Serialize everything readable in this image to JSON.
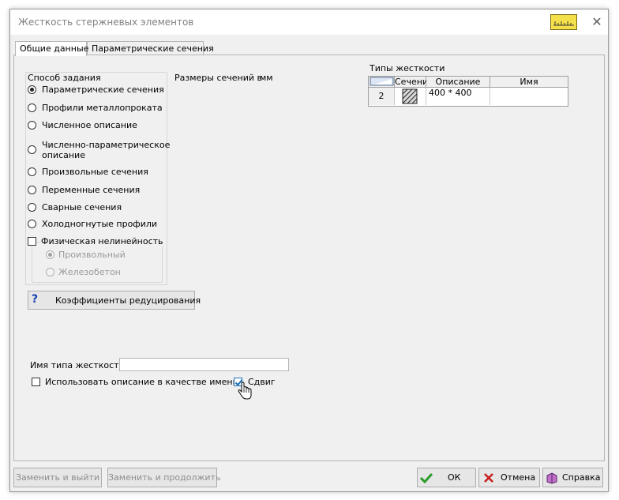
{
  "window": {
    "title": "Жесткость стержневых элементов",
    "close_glyph": "✕"
  },
  "tabs": [
    {
      "label": "Общие данные",
      "active": true
    },
    {
      "label": "Параметрические сечения",
      "active": false
    }
  ],
  "method_group": {
    "title": "Способ задания",
    "options": [
      {
        "label": "Параметрические сечения",
        "checked": true
      },
      {
        "label": "Профили металлопроката",
        "checked": false
      },
      {
        "label": "Численное описание",
        "checked": false
      },
      {
        "label": "Численно-параметрическое",
        "label2": "описание",
        "checked": false
      },
      {
        "label": "Произвольные сечения",
        "checked": false
      },
      {
        "label": "Переменные сечения",
        "checked": false
      },
      {
        "label": "Сварные сечения",
        "checked": false
      },
      {
        "label": "Холодногнутые профили",
        "checked": false
      }
    ]
  },
  "nonlinearity": {
    "label": "Физическая нелинейность",
    "checked": false,
    "options": [
      {
        "label": "Произвольный",
        "checked": true
      },
      {
        "label": "Железобетон",
        "checked": false
      }
    ]
  },
  "reduction_button": {
    "label": "Коэффициенты редуцирования",
    "icon": "question-icon"
  },
  "section_sizes": {
    "label": "Размеры сечений в",
    "unit": "мм"
  },
  "stiffness_types": {
    "title": "Типы жесткости",
    "columns": [
      "Сечени",
      "Описание",
      "Имя"
    ],
    "rows": [
      {
        "number": "2",
        "description": "400 * 400",
        "name": ""
      }
    ]
  },
  "stiffness_name": {
    "label": "Имя типа жесткости",
    "value": ""
  },
  "use_description": {
    "label": "Использовать описание в качестве имени",
    "checked": false
  },
  "shear": {
    "label": "Сдвиг",
    "checked": true
  },
  "footer": {
    "replace_exit": "Заменить и выйти",
    "replace_continue": "Заменить и продолжить",
    "ok": "ОК",
    "cancel": "Отмена",
    "help": "Справка"
  },
  "colors": {
    "accent": "#1b6fb5",
    "ok_green": "#2a9d2a",
    "cancel_red": "#c81e1e",
    "ruler_yellow": "#f4e04a"
  }
}
